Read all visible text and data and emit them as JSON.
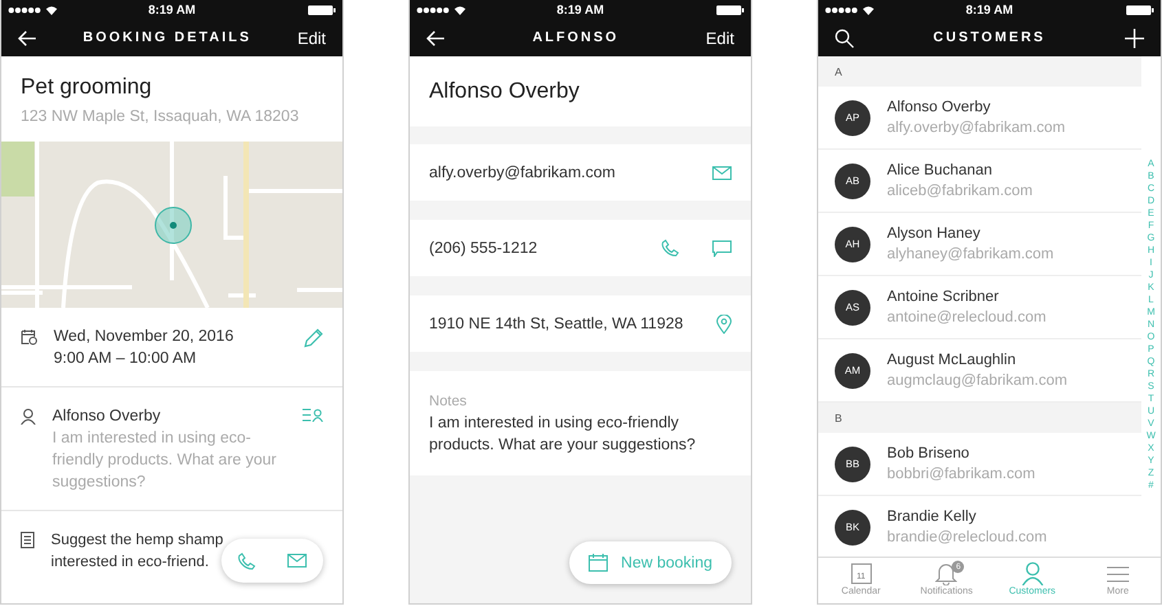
{
  "booking_details": {
    "status_bar": {
      "time": "8:19 AM"
    },
    "header": {
      "title": "BOOKING DETAILS",
      "action": "Edit"
    },
    "service": "Pet grooming",
    "address": "123 NW Maple St, Issaquah, WA 18203",
    "date_row": {
      "date": "Wed, November 20, 2016",
      "time": "9:00 AM – 10:00 AM"
    },
    "customer_row": {
      "name": "Alfonso Overby",
      "message": "I am interested in using eco-friendly products. What are your suggestions?"
    },
    "note_row": {
      "lines": [
        "Suggest the hemp shamp",
        "interested in eco-friend."
      ]
    }
  },
  "customer_details": {
    "status_bar": {
      "time": "8:19 AM"
    },
    "header": {
      "title": "ALFONSO",
      "action": "Edit"
    },
    "name": "Alfonso Overby",
    "contact_rows": [
      {
        "kind": "email",
        "value": "alfy.overby@fabrikam.com"
      },
      {
        "kind": "phone",
        "value": "(206) 555-1212"
      },
      {
        "kind": "address",
        "value": "1910 NE 14th St, Seattle, WA 11928"
      }
    ],
    "notes": {
      "label": "Notes",
      "text": "I am interested in using eco-friendly products. What are your suggestions?"
    },
    "new_booking_button": "New booking"
  },
  "customers": {
    "status_bar": {
      "time": "8:19 AM"
    },
    "header": {
      "title": "CUSTOMERS"
    },
    "sections": [
      {
        "letter": "A",
        "customers": [
          {
            "initials": "AP",
            "name": "Alfonso Overby",
            "email": "alfy.overby@fabrikam.com"
          },
          {
            "initials": "AB",
            "name": "Alice Buchanan",
            "email": "aliceb@fabrikam.com"
          },
          {
            "initials": "AH",
            "name": "Alyson Haney",
            "email": "alyhaney@fabrikam.com"
          },
          {
            "initials": "AS",
            "name": "Antoine Scribner",
            "email": "antoine@relecloud.com"
          },
          {
            "initials": "AM",
            "name": "August McLaughlin",
            "email": "augmclaug@fabrikam.com"
          }
        ]
      },
      {
        "letter": "B",
        "customers": [
          {
            "initials": "BB",
            "name": "Bob Briseno",
            "email": "bobbri@fabrikam.com"
          },
          {
            "initials": "BK",
            "name": "Brandie Kelly",
            "email": "brandie@relecloud.com"
          }
        ]
      }
    ],
    "alphabet_index": [
      "A",
      "B",
      "C",
      "D",
      "E",
      "F",
      "G",
      "H",
      "I",
      "J",
      "K",
      "L",
      "M",
      "N",
      "O",
      "P",
      "Q",
      "R",
      "S",
      "T",
      "U",
      "V",
      "W",
      "X",
      "Y",
      "Z",
      "#"
    ],
    "tab_bar": [
      {
        "kind": "calendar",
        "label": "Calendar",
        "icon_text": "11",
        "selected": false
      },
      {
        "kind": "notifications",
        "label": "Notifications",
        "badge": "6",
        "selected": false
      },
      {
        "kind": "customers",
        "label": "Customers",
        "selected": true
      },
      {
        "kind": "more",
        "label": "More",
        "selected": false
      }
    ]
  }
}
